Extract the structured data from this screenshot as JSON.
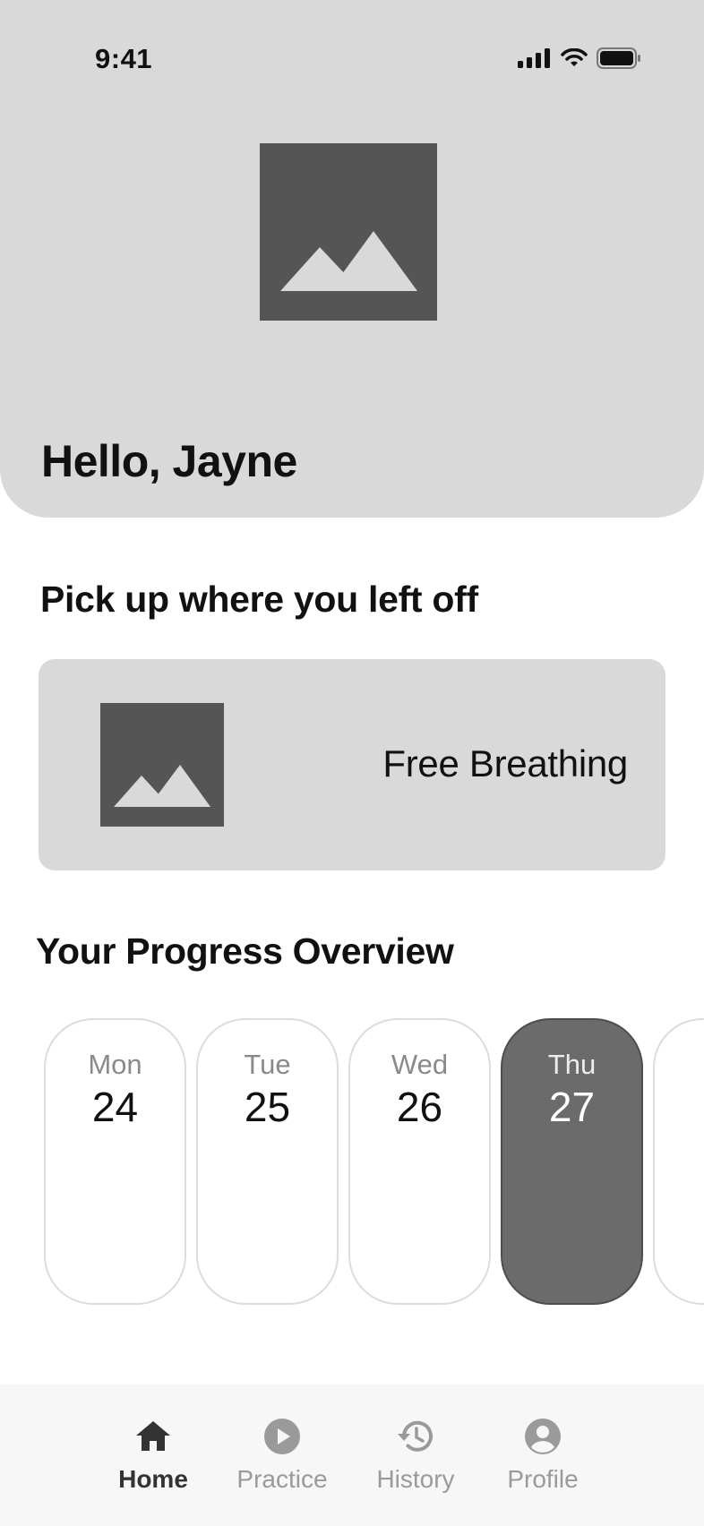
{
  "status_bar": {
    "time": "9:41"
  },
  "header": {
    "greeting": "Hello, Jayne"
  },
  "resume": {
    "section_title": "Pick up where you left off",
    "card_title": "Free Breathing"
  },
  "progress": {
    "section_title": "Your Progress Overview",
    "days": [
      {
        "name": "Mon",
        "date": "24",
        "selected": false
      },
      {
        "name": "Tue",
        "date": "25",
        "selected": false
      },
      {
        "name": "Wed",
        "date": "26",
        "selected": false
      },
      {
        "name": "Thu",
        "date": "27",
        "selected": true
      }
    ]
  },
  "tab_bar": {
    "tabs": [
      {
        "label": "Home",
        "icon": "home-icon",
        "active": true
      },
      {
        "label": "Practice",
        "icon": "play-icon",
        "active": false
      },
      {
        "label": "History",
        "icon": "history-icon",
        "active": false
      },
      {
        "label": "Profile",
        "icon": "profile-icon",
        "active": false
      }
    ]
  },
  "colors": {
    "surface": "#d9d9d9",
    "placeholder": "#555555",
    "selected_day": "#6b6b6b",
    "tab_bar": "#f7f7f7"
  }
}
